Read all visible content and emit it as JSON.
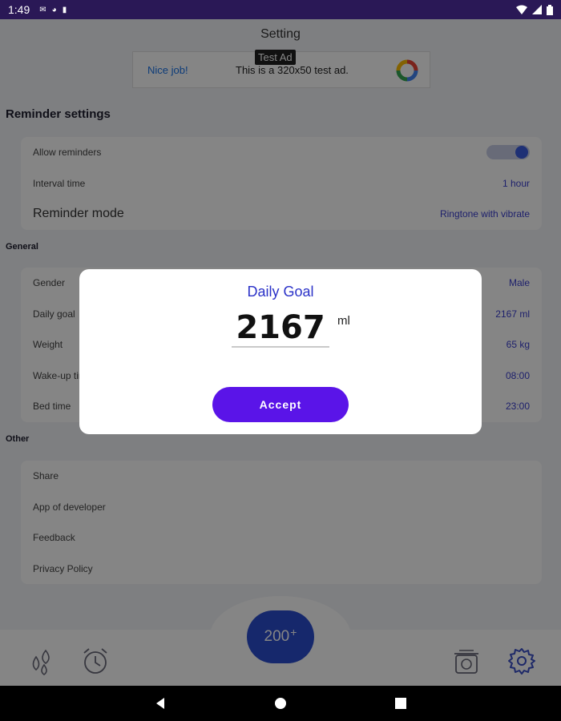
{
  "status_bar": {
    "time": "1:49",
    "left_icons": [
      "mail-icon",
      "notification-icon",
      "sim-icon"
    ],
    "right_icons": [
      "wifi-icon",
      "signal-icon",
      "battery-icon"
    ]
  },
  "screen_title": "Setting",
  "ad": {
    "label": "Test Ad",
    "brand_text": "Nice job!",
    "body_text": "This is a 320x50 test ad."
  },
  "reminder_section": {
    "title": "Reminder settings",
    "rows": [
      {
        "label": "Allow reminders",
        "toggle_on": true
      },
      {
        "label": "Interval time",
        "value": "1 hour"
      },
      {
        "label": "Reminder mode",
        "value": "Ringtone with vibrate"
      }
    ]
  },
  "general_section": {
    "title": "General",
    "rows": [
      {
        "label": "Gender",
        "value": "Male"
      },
      {
        "label": "Daily goal",
        "value": "2167 ml"
      },
      {
        "label": "Weight",
        "value": "65 kg"
      },
      {
        "label": "Wake-up time",
        "value": "08:00"
      },
      {
        "label": "Bed time",
        "value": "23:00"
      }
    ]
  },
  "other_section": {
    "title": "Other",
    "rows": [
      {
        "label": "Share"
      },
      {
        "label": "App of developer"
      },
      {
        "label": "Feedback"
      },
      {
        "label": "Privacy Policy"
      }
    ]
  },
  "bottom_nav": {
    "fab_value": "200",
    "fab_plus": "+",
    "icons": [
      "water-drops-icon",
      "alarm-clock-icon",
      "scale-icon",
      "gear-icon"
    ]
  },
  "dialog": {
    "title": "Daily Goal",
    "value": "2167",
    "unit": "ml",
    "accept_label": "Accept"
  },
  "colors": {
    "accent": "#3a3fcf",
    "accept_button": "#5a14e8",
    "status_bar": "#2a1856",
    "fab": "#2b4ecf"
  }
}
